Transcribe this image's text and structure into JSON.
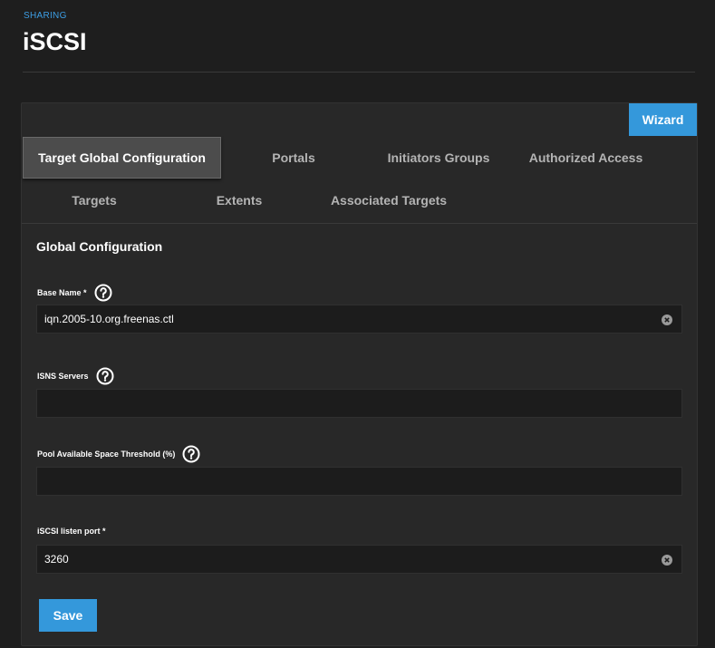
{
  "header": {
    "breadcrumb": "SHARING",
    "title": "iSCSI"
  },
  "card": {
    "wizard_label": "Wizard",
    "tabs": [
      {
        "label": "Target Global Configuration",
        "active": true
      },
      {
        "label": "Portals",
        "active": false
      },
      {
        "label": "Initiators Groups",
        "active": false
      },
      {
        "label": "Authorized Access",
        "active": false
      },
      {
        "label": "Targets",
        "active": false
      },
      {
        "label": "Extents",
        "active": false
      },
      {
        "label": "Associated Targets",
        "active": false
      }
    ],
    "section_title": "Global Configuration",
    "fields": {
      "base_name": {
        "label": "Base Name *",
        "value": "iqn.2005-10.org.freenas.ctl"
      },
      "isns_servers": {
        "label": "ISNS Servers",
        "value": ""
      },
      "pool_threshold": {
        "label": "Pool Available Space Threshold (%)",
        "value": ""
      },
      "listen_port": {
        "label": "iSCSI listen port *",
        "value": "3260"
      }
    },
    "save_label": "Save"
  },
  "colors": {
    "accent": "#3498db",
    "background": "#1e1e1e",
    "card": "#282828",
    "input": "#1c1c1c"
  },
  "icons": {
    "help": "help-circle-icon",
    "clear": "clear-circle-icon"
  }
}
